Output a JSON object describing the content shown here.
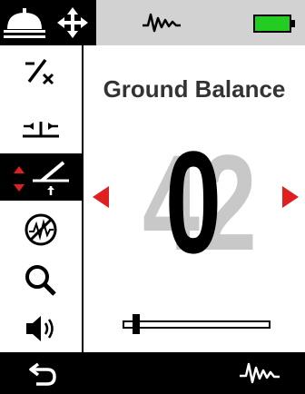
{
  "screen": {
    "title": "Ground Balance",
    "value": "0",
    "ghost_value": "42",
    "slider_value_fraction": 0.05
  },
  "colors": {
    "accent_red": "#e02020",
    "battery_green": "#22cc22",
    "top_bar": "#d2d2d2",
    "black": "#000000"
  },
  "topbar": {
    "icons": [
      "all-metal-mode-icon",
      "move-icon",
      "waveform-icon",
      "battery-icon"
    ]
  },
  "sidebar": {
    "items": [
      {
        "icon": "discrimination-icon"
      },
      {
        "icon": "threshold-icon"
      },
      {
        "icon": "ground-balance-icon",
        "active": true
      },
      {
        "icon": "noise-cancel-icon"
      },
      {
        "icon": "search-icon"
      },
      {
        "icon": "volume-icon"
      }
    ]
  },
  "bottombar": {
    "icons": [
      "back-arrow-icon",
      "waveform-icon"
    ]
  }
}
